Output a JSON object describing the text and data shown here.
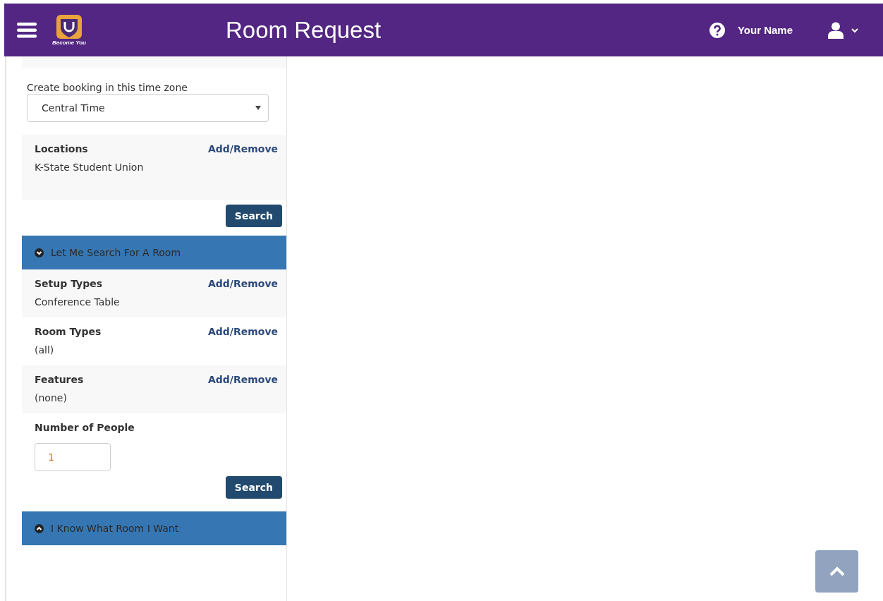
{
  "header": {
    "logo_caption": "Become You",
    "title": "Room Request",
    "user_name": "Your Name"
  },
  "timezone": {
    "label": "Create booking in this time zone",
    "value": "Central Time"
  },
  "locations": {
    "label": "Locations",
    "action": "Add/Remove",
    "value": "K-State Student Union"
  },
  "locations_search": "Search",
  "panels": [
    {
      "title": "Let Me Search For A Room",
      "expanded": true,
      "criteria": [
        {
          "label": "Setup Types",
          "action": "Add/Remove",
          "value": "Conference Table"
        },
        {
          "label": "Room Types",
          "action": "Add/Remove",
          "value": "(all)"
        },
        {
          "label": "Features",
          "action": "Add/Remove",
          "value": "(none)"
        }
      ],
      "people": {
        "label": "Number of People",
        "value": "1"
      },
      "search": "Search"
    },
    {
      "title": "I Know What Room I Want",
      "expanded": false
    }
  ]
}
